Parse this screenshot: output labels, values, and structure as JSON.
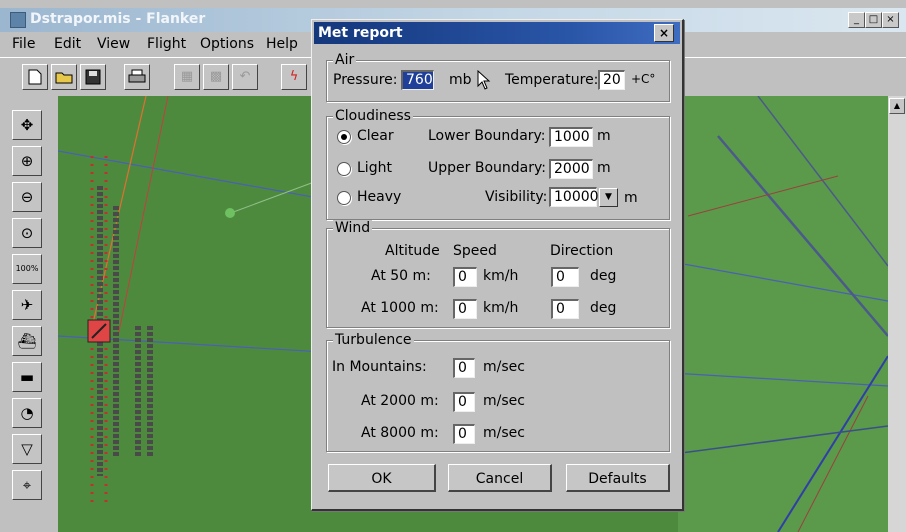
{
  "window": {
    "title": "Dstrapor.mis - Flanker",
    "min": "_",
    "max": "□",
    "close": "×"
  },
  "menu": [
    {
      "label": "File"
    },
    {
      "label": "Edit"
    },
    {
      "label": "View"
    },
    {
      "label": "Flight"
    },
    {
      "label": "Options"
    },
    {
      "label": "Help"
    }
  ],
  "dialog": {
    "title": "Met report",
    "close": "×",
    "air": {
      "legend": "Air",
      "pressure_label": "Pressure:",
      "pressure_value": "760",
      "pressure_unit": "mb",
      "temperature_label": "Temperature:",
      "temperature_value": "20",
      "temperature_unit": "+C°"
    },
    "cloudiness": {
      "legend": "Cloudiness",
      "options": [
        "Clear",
        "Light",
        "Heavy"
      ],
      "selected": "Clear",
      "lower_label": "Lower Boundary:",
      "lower_value": "1000",
      "lower_unit": "m",
      "upper_label": "Upper Boundary:",
      "upper_value": "2000",
      "upper_unit": "m",
      "visibility_label": "Visibility:",
      "visibility_value": "10000",
      "visibility_unit": "m"
    },
    "wind": {
      "legend": "Wind",
      "col_altitude": "Altitude",
      "col_speed": "Speed",
      "col_direction": "Direction",
      "rows": [
        {
          "label": "At 50 m:",
          "speed": "0",
          "speed_unit": "km/h",
          "direction": "0",
          "direction_unit": "deg"
        },
        {
          "label": "At 1000 m:",
          "speed": "0",
          "speed_unit": "km/h",
          "direction": "0",
          "direction_unit": "deg"
        }
      ]
    },
    "turbulence": {
      "legend": "Turbulence",
      "rows": [
        {
          "label": "In Mountains:",
          "value": "0",
          "unit": "m/sec"
        },
        {
          "label": "At 2000 m:",
          "value": "0",
          "unit": "m/sec"
        },
        {
          "label": "At 8000 m:",
          "value": "0",
          "unit": "m/sec"
        }
      ]
    },
    "buttons": {
      "ok": "OK",
      "cancel": "Cancel",
      "defaults": "Defaults"
    }
  },
  "toolbar_icons": [
    "new-icon",
    "open-icon",
    "save-icon",
    "print-icon",
    "grid-icon",
    "pattern-icon",
    "undo-icon",
    "lightning-icon"
  ],
  "left_tools": [
    "move-icon",
    "zoom-in-icon",
    "zoom-out-icon",
    "zoom-fit-icon",
    "zoom-100-icon",
    "aircraft-icon",
    "ship-icon",
    "tank-icon",
    "radar-icon",
    "waypoint-icon",
    "target-icon"
  ],
  "left_tool_glyphs": {
    "zoom_100": "100%"
  },
  "colors": {
    "dialog_title_bar": "#14377c",
    "map_ground": "#4e8a3e",
    "window_title_bar": "#9bb6cf"
  }
}
